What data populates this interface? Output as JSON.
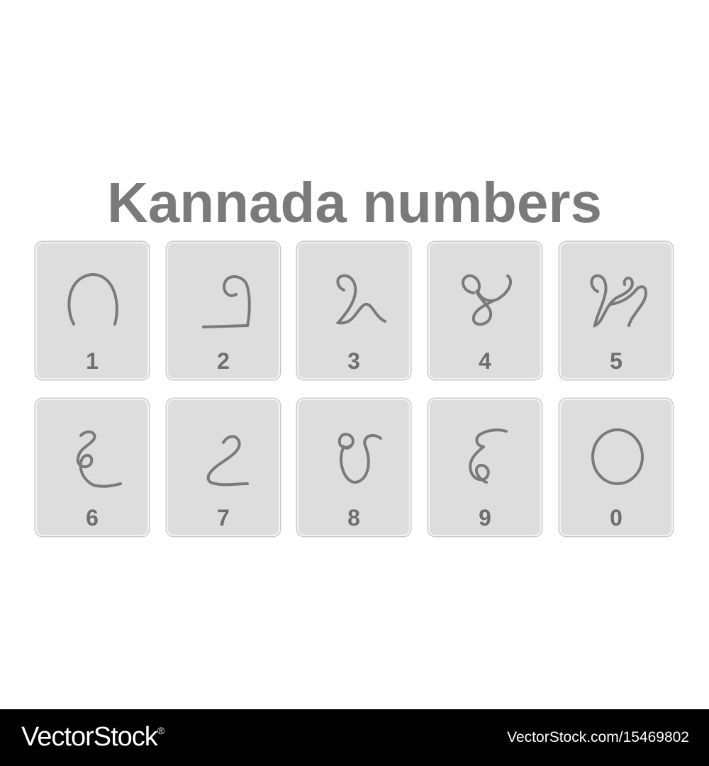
{
  "title": "Kannada numbers",
  "colors": {
    "background": "#ffffff",
    "card_fill": "#dddddd",
    "card_border": "#c9c9c9",
    "glyph_stroke": "#7a7a7a",
    "text": "#7a7a7a",
    "footer": "#000000"
  },
  "cards": [
    {
      "label": "1",
      "icon": "kannada-digit-1-icon"
    },
    {
      "label": "2",
      "icon": "kannada-digit-2-icon"
    },
    {
      "label": "3",
      "icon": "kannada-digit-3-icon"
    },
    {
      "label": "4",
      "icon": "kannada-digit-4-icon"
    },
    {
      "label": "5",
      "icon": "kannada-digit-5-icon"
    },
    {
      "label": "6",
      "icon": "kannada-digit-6-icon"
    },
    {
      "label": "7",
      "icon": "kannada-digit-7-icon"
    },
    {
      "label": "8",
      "icon": "kannada-digit-8-icon"
    },
    {
      "label": "9",
      "icon": "kannada-digit-9-icon"
    },
    {
      "label": "0",
      "icon": "kannada-digit-0-icon"
    }
  ],
  "footer": {
    "brand": "VectorStock",
    "brand_mark": "®",
    "image_id": "VectorStock.com/15469802"
  }
}
